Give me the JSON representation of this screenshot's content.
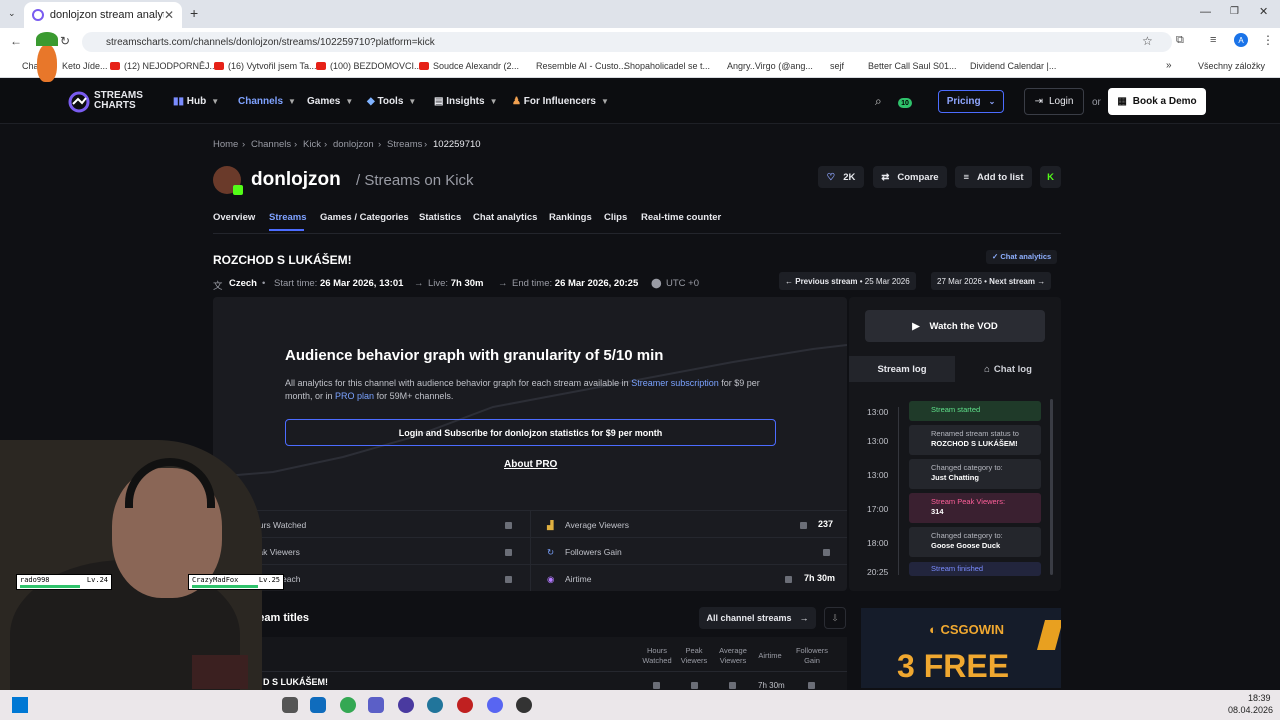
{
  "browser": {
    "tab_title": "donlojzon stream analytics & s",
    "url": "streamscharts.com/channels/donlojzon/streams/102259710?platform=kick",
    "profile_initial": "A",
    "bookmarks": [
      "Chat",
      "Keto Jíde...",
      "(12) NEJODPORNĚJ...",
      "(16) Vytvořil jsem Ta...",
      "(100) BEZDOMOVCI...",
      "Soudce Alexandr (2...",
      "Resemble AI - Custo...",
      "Shopaholicadel se t...",
      "Angry..Virgo (@ang...",
      "sejf",
      "Better Call Saul S01...",
      "Dividend Calendar |..."
    ],
    "all_bookmarks": "Všechny záložky"
  },
  "nav": {
    "logo_line1": "STREAMS",
    "logo_line2": "CHARTS",
    "items": [
      "Hub",
      "Channels",
      "Games",
      "Tools",
      "Insights",
      "For Influencers"
    ],
    "pricing": "Pricing",
    "login": "Login",
    "or": "or",
    "book_demo": "Book a Demo",
    "notif_count": "10"
  },
  "breadcrumb": [
    "Home",
    "Channels",
    "Kick",
    "donlojzon",
    "Streams",
    "102259710"
  ],
  "channel": {
    "name": "donlojzon",
    "subtitle": "/ Streams on Kick",
    "followers": "2K",
    "compare": "Compare",
    "add_to_list": "Add to list"
  },
  "subtabs": [
    "Overview",
    "Streams",
    "Games / Categories",
    "Statistics",
    "Chat analytics",
    "Rankings",
    "Clips",
    "Real-time counter"
  ],
  "stream": {
    "title": "ROZCHOD S LUKÁŠEM!",
    "chat_analytics": "Chat analytics",
    "language": "Czech",
    "start_label": "Start time:",
    "start_value": "26 Mar 2026, 13:01",
    "live_label": "Live:",
    "live_value": "7h 30m",
    "end_label": "End time:",
    "end_value": "26 Mar 2026, 20:25",
    "timezone": "UTC +0",
    "prev_label": "Previous stream",
    "prev_date": "25 Mar 2026",
    "next_date": "27 Mar 2026",
    "next_label": "Next stream"
  },
  "promo": {
    "title": "Audience behavior graph with granularity of 5/10 min",
    "text_a": "All analytics for this channel with audience behavior graph for each stream available in ",
    "link_a": "Streamer subscription",
    "text_b": " for $9 per month, or in ",
    "link_b": "PRO plan",
    "text_c": " for 59M+ channels.",
    "button": "Login and Subscribe for donlojzon statistics for $9 per month",
    "about": "About PRO"
  },
  "stats": {
    "hours_watched": "Hours Watched",
    "peak_viewers": "Peak Viewers",
    "reach": "each",
    "average_viewers": "Average Viewers",
    "average_viewers_value": "237",
    "followers_gain": "Followers Gain",
    "airtime": "Airtime",
    "airtime_value": "7h 30m"
  },
  "right": {
    "watch_vod": "Watch the VOD",
    "tab_stream_log": "Stream log",
    "tab_chat_log": "Chat log",
    "log": [
      {
        "time": "13:00",
        "label": "Stream started",
        "detail": ""
      },
      {
        "time": "13:00",
        "label": "Renamed stream status to",
        "detail": "ROZCHOD S LUKÁŠEM!"
      },
      {
        "time": "13:00",
        "label": "Changed category to:",
        "detail": "Just Chatting"
      },
      {
        "time": "17:00",
        "label": "Stream Peak Viewers:",
        "detail": "314"
      },
      {
        "time": "18:00",
        "label": "Changed category to:",
        "detail": "Goose Goose Duck"
      },
      {
        "time": "20:25",
        "label": "Stream finished",
        "detail": ""
      }
    ]
  },
  "bottom": {
    "stream_titles": "Stream titles",
    "all_channel_streams": "All channel streams",
    "col_hours": "Hours Watched",
    "col_peak": "Peak Viewers",
    "col_avg": "Average Viewers",
    "col_airtime": "Airtime",
    "col_followers": "Followers Gain",
    "row_title": "D S LUKÁŠEM!",
    "row_airtime": "7h 30m",
    "ad_brand": "CSGOWIN",
    "ad_headline": "3 FREE"
  },
  "overlay": {
    "player1": "rado998",
    "player1_lv": "Lv.24",
    "player2": "CrazyMadFox",
    "player2_lv": "Lv.25"
  },
  "taskbar": {
    "time": "18:39",
    "date": "08.04.2026"
  }
}
